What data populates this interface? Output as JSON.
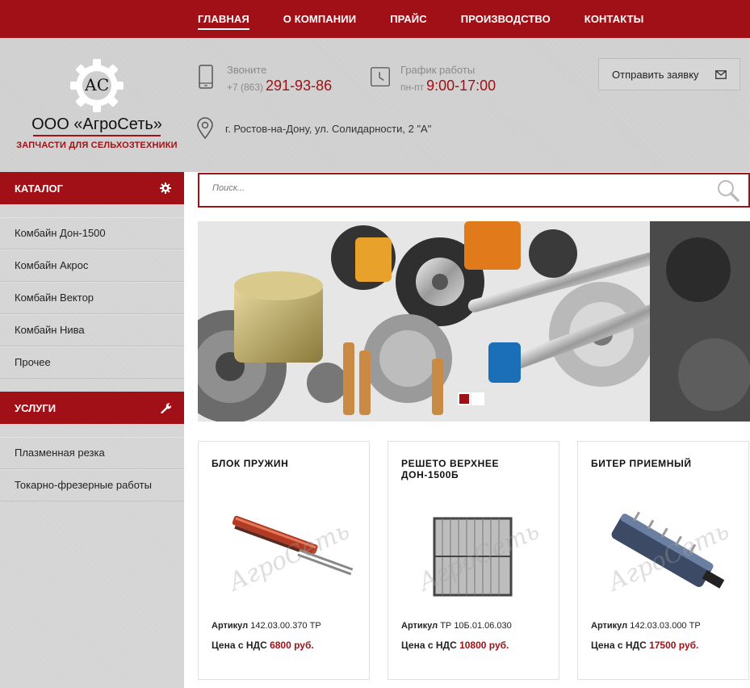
{
  "nav": {
    "items": [
      {
        "label": "ГЛАВНАЯ",
        "active": true
      },
      {
        "label": "О КОМПАНИИ"
      },
      {
        "label": "ПРАЙС"
      },
      {
        "label": "ПРОИЗВОДСТВО"
      },
      {
        "label": "КОНТАКТЫ"
      }
    ]
  },
  "header": {
    "logo_letters": "АС",
    "company": "ООО «АгроСеть»",
    "tagline": "ЗАПЧАСТИ ДЛЯ СЕЛЬХОЗТЕХНИКИ",
    "phone": {
      "label": "Звоните",
      "prefix": "+7 (863)",
      "number": "291-93-86",
      "icon": "phone-icon"
    },
    "schedule": {
      "label": "График работы",
      "days": "пн-пт",
      "hours": "9:00-17:00",
      "icon": "clock-icon"
    },
    "address": {
      "text": "г. Ростов-на-Дону, ул. Солидарности, 2 \"А\"",
      "icon": "map-pin-icon"
    },
    "send_request": {
      "label": "Отправить заявку",
      "icon": "envelope-icon"
    }
  },
  "sidebar": {
    "catalog": {
      "title": "КАТАЛОГ",
      "icon": "gear-icon",
      "items": [
        "Комбайн Дон-1500",
        "Комбайн Акрос",
        "Комбайн Вектор",
        "Комбайн Нива",
        "Прочее"
      ]
    },
    "services": {
      "title": "УСЛУГИ",
      "icon": "wrench-icon",
      "items": [
        "Плазменная резка",
        "Токарно-фрезерные работы"
      ]
    }
  },
  "search": {
    "placeholder": "Поиск...",
    "icon": "search-icon"
  },
  "banner": {
    "slides": 2,
    "active_slide": 1
  },
  "products": [
    {
      "title": "БЛОК ПРУЖИН",
      "sku_label": "Артикул",
      "sku": "142.03.00.370 ТР",
      "price_label": "Цена с НДС",
      "price": "6800 руб.",
      "watermark": "АгроСеть"
    },
    {
      "title": "РЕШЕТО ВЕРХНЕЕ ДОН-1500Б",
      "sku_label": "Артикул",
      "sku": "ТР 10Б.01.06.030",
      "price_label": "Цена с НДС",
      "price": "10800 руб.",
      "watermark": "АгроСеть"
    },
    {
      "title": "БИТЕР ПРИЕМНЫЙ",
      "sku_label": "Артикул",
      "sku": "142.03.03.000 ТР",
      "price_label": "Цена с НДС",
      "price": "17500 руб.",
      "watermark": "АгроСеть"
    }
  ],
  "colors": {
    "brand": "#a01016",
    "header_bg": "#cfcfcf",
    "sidebar_bg": "#d4d4d4"
  }
}
